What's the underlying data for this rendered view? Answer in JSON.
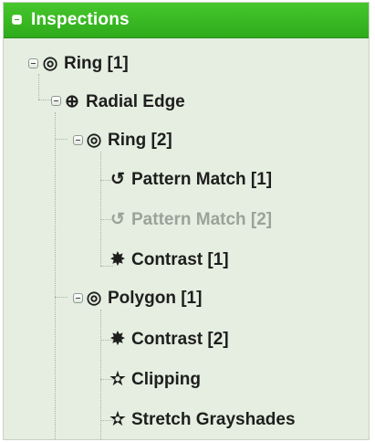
{
  "tree": {
    "root_label": "Inspections",
    "nodes": {
      "ring1": {
        "icon": "target-icon",
        "glyph": "◎",
        "label": "Ring [1]"
      },
      "radial_edge": {
        "icon": "crosshair-icon",
        "glyph": "⊕",
        "label": "Radial Edge"
      },
      "ring2": {
        "icon": "target-icon",
        "glyph": "◎",
        "label": "Ring [2]"
      },
      "pattern_match1": {
        "icon": "rotate-icon",
        "glyph": "↺",
        "label": "Pattern Match [1]"
      },
      "pattern_match2": {
        "icon": "rotate-icon",
        "glyph": "↺",
        "label": "Pattern Match [2]"
      },
      "contrast1": {
        "icon": "burst-icon",
        "glyph": "✸",
        "label": "Contrast [1]"
      },
      "polygon1": {
        "icon": "target-icon",
        "glyph": "◎",
        "label": "Polygon [1]"
      },
      "contrast2": {
        "icon": "burst-icon",
        "glyph": "✸",
        "label": "Contrast [2]"
      },
      "clipping": {
        "icon": "star-icon",
        "glyph": "✫",
        "label": "Clipping"
      },
      "stretch": {
        "icon": "star-icon",
        "glyph": "✫",
        "label": "Stretch Grayshades"
      }
    }
  },
  "colors": {
    "header_green": "#2eab1b",
    "panel_bg": "#e5eee0",
    "disabled_text": "#9aa39a"
  }
}
